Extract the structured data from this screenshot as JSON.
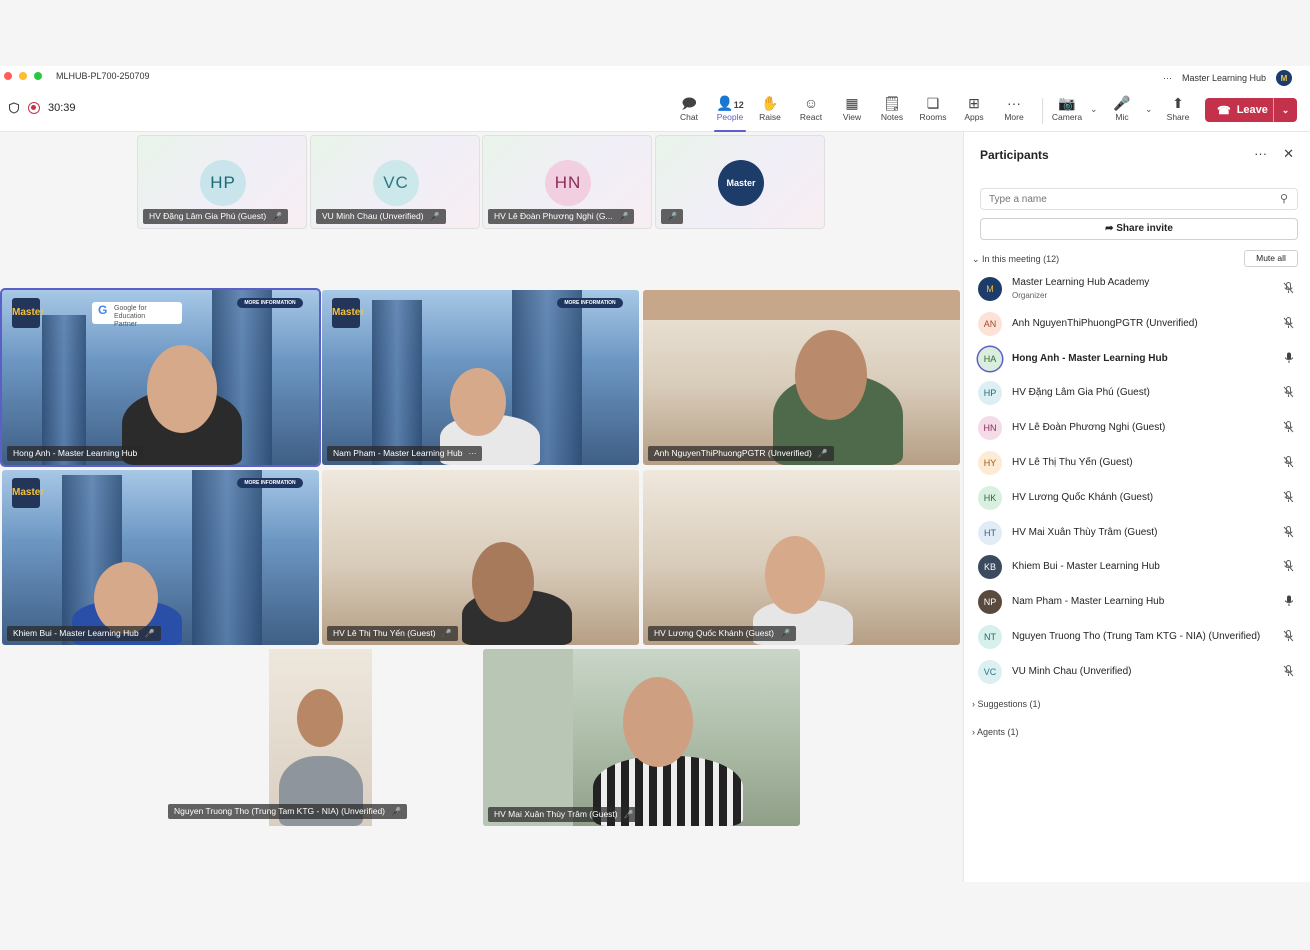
{
  "window": {
    "title": "MLHUB-PL700-250709",
    "account": "Master Learning Hub",
    "more": "···",
    "avatar": "M"
  },
  "call": {
    "timer": "30:39"
  },
  "toolbar": {
    "chat": "Chat",
    "people": "People",
    "people_count": "12",
    "raise": "Raise",
    "react": "React",
    "view": "View",
    "notes": "Notes",
    "rooms": "Rooms",
    "apps": "Apps",
    "more": "More",
    "camera": "Camera",
    "mic": "Mic",
    "share": "Share",
    "leave": "Leave"
  },
  "top_tiles": [
    {
      "initials": "HP",
      "label": "HV Đặng Lâm Gia Phú (Guest)",
      "color": "#c9e4ea",
      "text": "#1b6a78"
    },
    {
      "initials": "VC",
      "label": "VU Minh Chau (Unverified)",
      "color": "#cde8ea",
      "text": "#2b7882"
    },
    {
      "initials": "HN",
      "label": "HV Lê Đoàn Phương Nghi (G...",
      "color": "#f1cfe0",
      "text": "#8a2c5a"
    },
    {
      "initials": "Master",
      "label": "",
      "color": "#1d3c6a",
      "text": "#ffffff"
    }
  ],
  "video_tiles": [
    {
      "label": "Hong Anh - Master Learning Hub",
      "bg": "city"
    },
    {
      "label": "Nam Pham - Master Learning Hub",
      "bg": "city"
    },
    {
      "label": "Anh NguyenThiPhuongPGTR (Unverified)",
      "bg": "room"
    },
    {
      "label": "Khiem Bui - Master Learning Hub",
      "bg": "city"
    },
    {
      "label": "HV Lê Thị Thu Yến (Guest)",
      "bg": "room"
    },
    {
      "label": "HV Lương Quốc Khánh (Guest)",
      "bg": "room"
    },
    {
      "label": "Nguyen Truong Tho (Trung Tam KTG - NIA) (Unverified)",
      "bg": "plain"
    },
    {
      "label": "HV Mai Xuân Thùy Trâm (Guest)",
      "bg": "green"
    }
  ],
  "branding": {
    "logo": "Master",
    "google_line1": "Google for Education",
    "google_line2": "Partner",
    "more_info": "MORE INFORMATION"
  },
  "panel": {
    "title": "Participants",
    "search_placeholder": "Type a name",
    "share_invite": "Share invite",
    "in_meeting": "In this meeting (12)",
    "mute_all": "Mute all",
    "suggestions": "Suggestions (1)",
    "agents": "Agents (1)",
    "participants": [
      {
        "initials": "M",
        "name": "Master Learning Hub Academy",
        "sub": "Organizer",
        "bg": "#1d3c6a",
        "fg": "#f4c13e",
        "mic": "off"
      },
      {
        "initials": "AN",
        "name": "Anh NguyenThiPhuongPGTR (Unverified)",
        "sub": "",
        "bg": "#fde2d8",
        "fg": "#a34a2a",
        "mic": "off"
      },
      {
        "initials": "HA",
        "name": "Hong Anh - Master Learning Hub",
        "sub": "",
        "bg": "#dbeedd",
        "fg": "#2f6b36",
        "mic": "on"
      },
      {
        "initials": "HP",
        "name": "HV Đặng Lâm Gia Phú (Guest)",
        "sub": "",
        "bg": "#dceff3",
        "fg": "#1b6a78",
        "mic": "off"
      },
      {
        "initials": "HN",
        "name": "HV Lê Đoàn Phương Nghi (Guest)",
        "sub": "",
        "bg": "#f3dbe7",
        "fg": "#8a2c5a",
        "mic": "off"
      },
      {
        "initials": "HY",
        "name": "HV Lê Thị Thu Yến (Guest)",
        "sub": "",
        "bg": "#fdebd3",
        "fg": "#9a5a16",
        "mic": "off"
      },
      {
        "initials": "HK",
        "name": "HV Lương Quốc Khánh (Guest)",
        "sub": "",
        "bg": "#d9efe0",
        "fg": "#2a6a41",
        "mic": "off"
      },
      {
        "initials": "HT",
        "name": "HV Mai Xuân Thùy Trâm (Guest)",
        "sub": "",
        "bg": "#e2ecf6",
        "fg": "#3a5e86",
        "mic": "off"
      },
      {
        "initials": "KB",
        "name": "Khiem Bui - Master Learning Hub",
        "sub": "",
        "bg": "#3b4a5e",
        "fg": "#ffffff",
        "mic": "off"
      },
      {
        "initials": "NP",
        "name": "Nam Pham - Master Learning Hub",
        "sub": "",
        "bg": "#5a4a3e",
        "fg": "#ffffff",
        "mic": "on"
      },
      {
        "initials": "NT",
        "name": "Nguyen Truong Tho (Trung Tam KTG - NIA) (Unverified)",
        "sub": "",
        "bg": "#d8f0ec",
        "fg": "#1f6d62",
        "mic": "off"
      },
      {
        "initials": "VC",
        "name": "VU Minh Chau (Unverified)",
        "sub": "",
        "bg": "#dcf0f2",
        "fg": "#2b7882",
        "mic": "off"
      }
    ]
  }
}
